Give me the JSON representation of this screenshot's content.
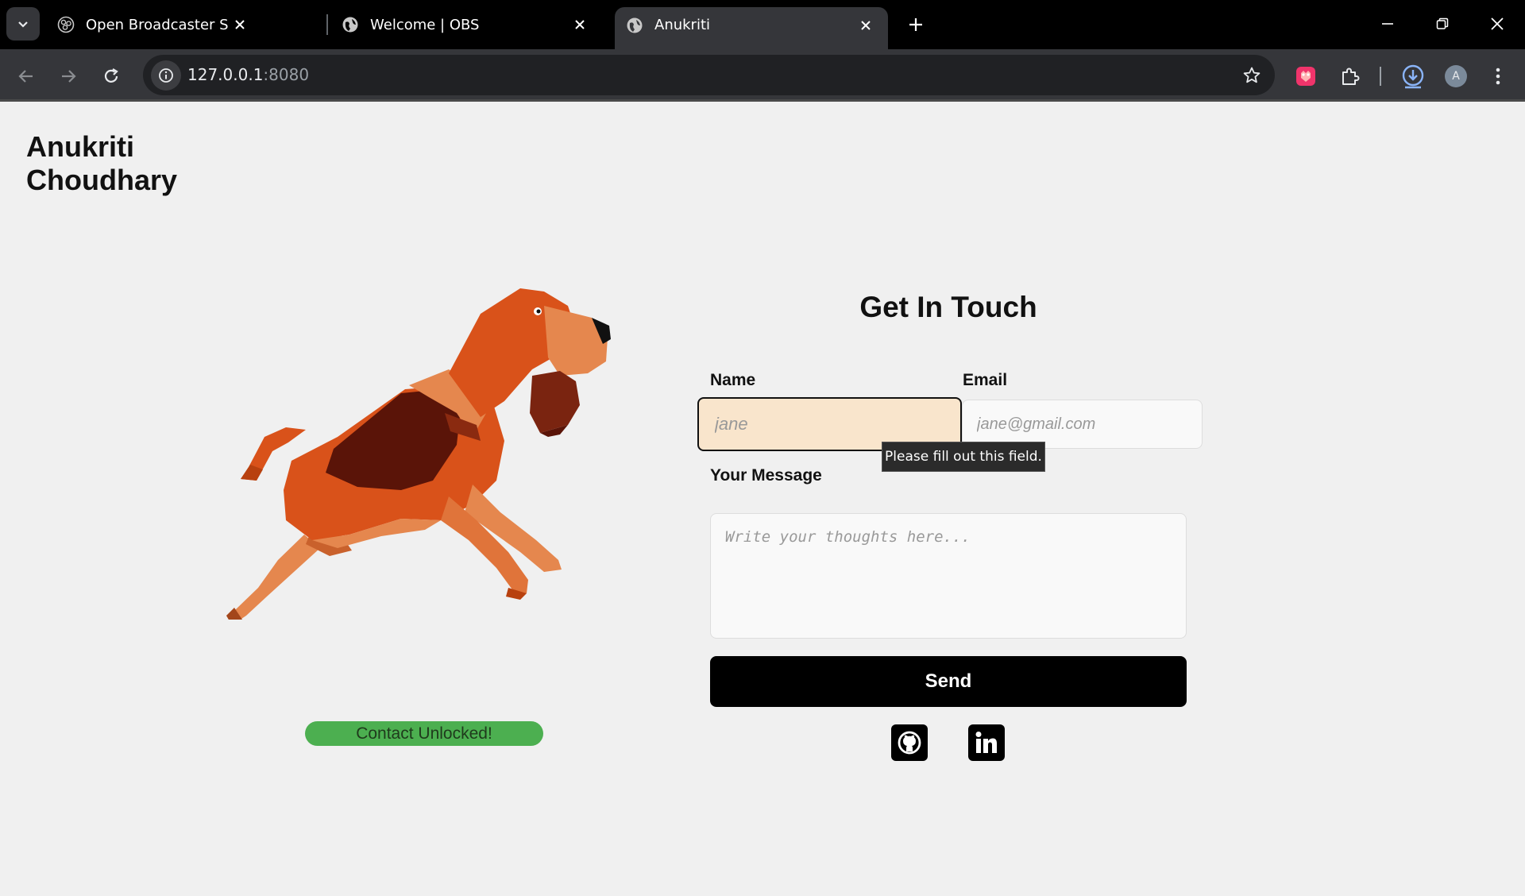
{
  "browser": {
    "tabs": [
      {
        "title": "Open Broadcaster Software | OI",
        "active": false
      },
      {
        "title": "Welcome | OBS",
        "active": false
      },
      {
        "title": "Anukriti",
        "active": true
      }
    ],
    "url_host": "127.0.0.1",
    "url_port": ":8080",
    "profile_initial": "A",
    "colors": {
      "tabbar": "#000000",
      "toolbar": "#35363a",
      "omnibox": "#202124"
    }
  },
  "page": {
    "brand": {
      "line1": "Anukriti",
      "line2": "Choudhary"
    },
    "status_pill": "Contact Unlocked!",
    "contact": {
      "title": "Get In Touch",
      "name_label": "Name",
      "name_placeholder": "jane",
      "email_label": "Email",
      "email_placeholder": "jane@gmail.com",
      "message_label": "Your Message",
      "message_placeholder": "Write your thoughts here...",
      "send_label": "Send",
      "validation_tooltip": "Please fill out this field."
    },
    "social": [
      {
        "icon": "github-icon"
      },
      {
        "icon": "linkedin-icon"
      }
    ],
    "colors": {
      "background": "#f0f0f0",
      "status_green": "#4caf50",
      "name_field_bg": "#f9e5cc",
      "button": "#000000"
    }
  }
}
